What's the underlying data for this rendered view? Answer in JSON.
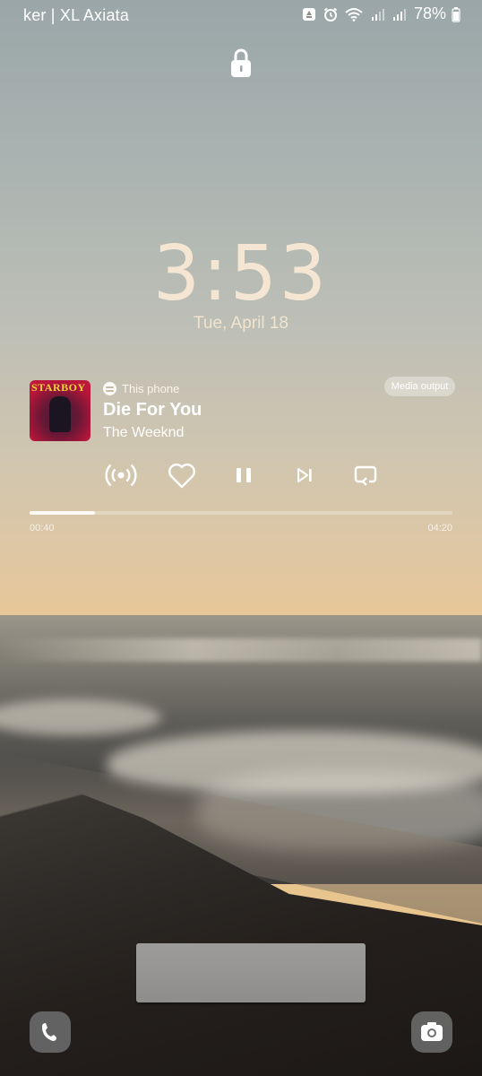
{
  "status_bar": {
    "carrier": "ker | XL Axiata",
    "battery": "78%"
  },
  "lockscreen": {
    "time": "3:53",
    "date": "Tue, April 18"
  },
  "media": {
    "source_label": "This phone",
    "title": "Die For You",
    "artist": "The Weeknd",
    "album_art_text": "STARBOY",
    "output_button": "Media output",
    "elapsed": "00:40",
    "duration": "04:20",
    "progress_fraction": 0.154,
    "controls": [
      "cast-icon",
      "heart-icon",
      "pause-icon",
      "skip-next-icon",
      "repeat-icon"
    ]
  },
  "shortcuts": {
    "left": "phone-icon",
    "right": "camera-icon"
  },
  "colors": {
    "clock": "#f4e6d2",
    "art_red": "#c41c3d",
    "art_title": "#f6d23a"
  }
}
